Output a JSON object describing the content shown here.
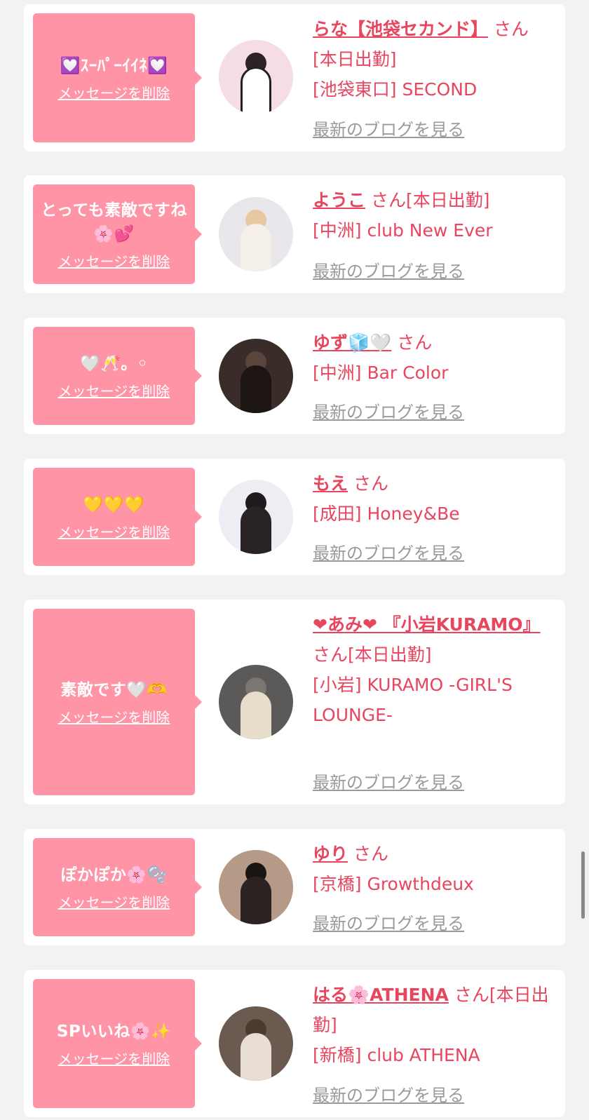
{
  "common": {
    "delete_label": "メッセージを削除",
    "blog_label": "最新のブログを見る",
    "san": "さん"
  },
  "colors": {
    "accent": "#e8455f",
    "bubble": "#ff94a7",
    "card": "#ffffff",
    "background": "#f2f2f2",
    "link_gray": "#9a9a9a"
  },
  "cards": [
    {
      "message": "💟ｽｰﾊﾟｰｲｲﾈ💟",
      "name": "らな【池袋セカンド】",
      "suffix": "[本日出勤]",
      "shop": "[池袋東口] SECOND",
      "avatar_icon": "maid-girl-avatar"
    },
    {
      "message": "とっても素敵ですね🌸💕",
      "name": "ようこ",
      "suffix": "[本日出勤]",
      "shop": "[中洲] club New Ever",
      "avatar_icon": "blonde-girl-avatar"
    },
    {
      "message": "🤍🥂。◦",
      "name": "ゆず🧊🤍",
      "suffix": "",
      "shop": "[中洲] Bar Color",
      "avatar_icon": "dark-hair-girl-avatar"
    },
    {
      "message": "💛💛💛",
      "name": "もえ",
      "suffix": "",
      "shop": "[成田] Honey&Be",
      "avatar_icon": "posing-girl-avatar"
    },
    {
      "message": "素敵です🤍🫶",
      "name": "❤あみ❤ 『小岩KURAMO』",
      "suffix": "[本日出勤]",
      "shop": "[小岩] KURAMO -GIRL'S LOUNGE-",
      "avatar_icon": "street-avatar"
    },
    {
      "message": "ぽかぽか🌸🫧",
      "name": "ゆり",
      "suffix": "",
      "shop": "[京橋] Growthdeux",
      "avatar_icon": "short-hair-girl-avatar"
    },
    {
      "message": "SPいいね🌸✨",
      "name": "はる🌸ATHENA",
      "suffix": "[本日出勤]",
      "shop": "[新橋] club ATHENA",
      "avatar_icon": "dress-girl-avatar"
    }
  ]
}
